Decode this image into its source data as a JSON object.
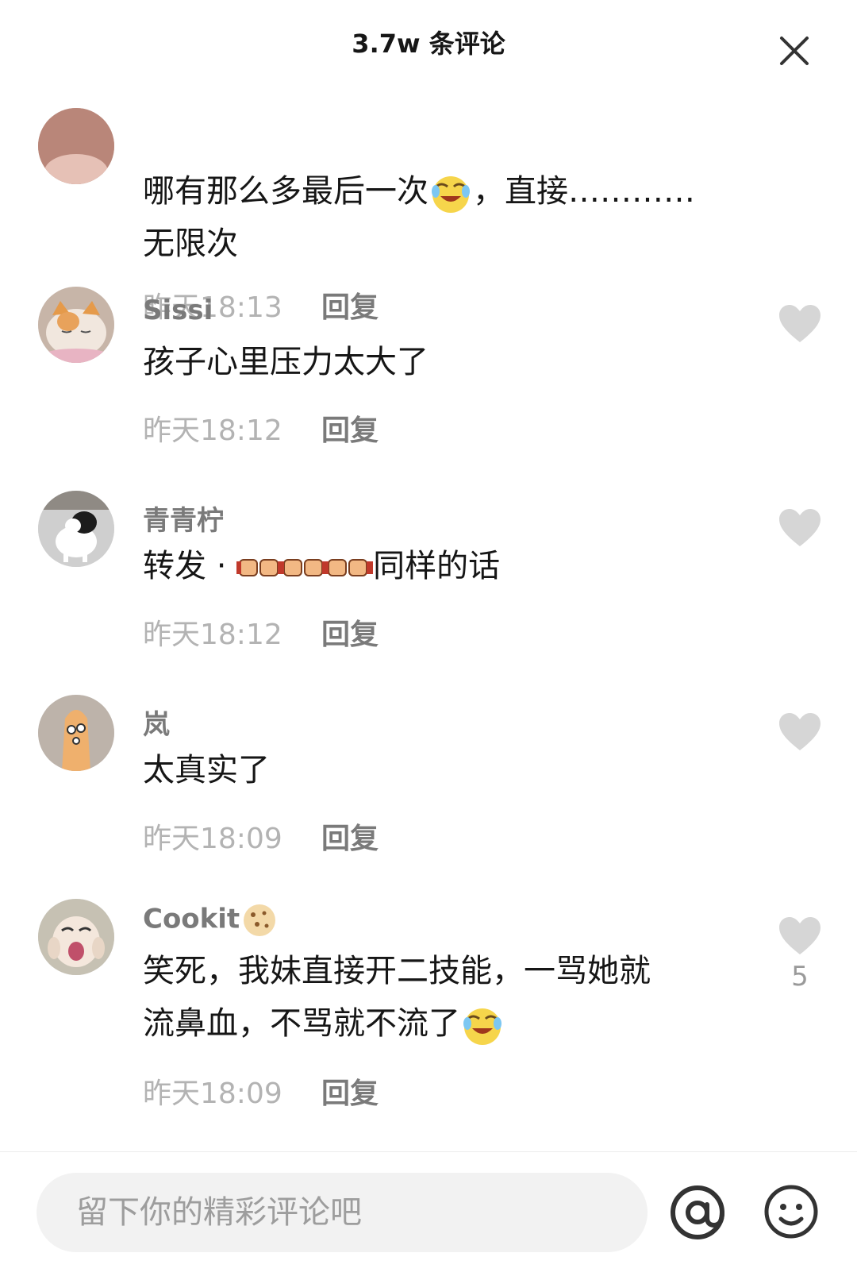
{
  "header": {
    "title": "3.7w 条评论",
    "close_icon": "close-icon"
  },
  "comments": [
    {
      "username": "",
      "content_parts": [
        "哪有那么多最后一次",
        "，直接…………",
        "无限次"
      ],
      "time": "昨天18:13",
      "reply": "回复",
      "liked": false
    },
    {
      "username": "Sissi",
      "content": "孩子心里压力太大了",
      "time": "昨天18:12",
      "reply": "回复"
    },
    {
      "username": "青青柠",
      "content_prefix": "转发 · ",
      "content_suffix": "同样的话",
      "time": "昨天18:12",
      "reply": "回复"
    },
    {
      "username": "岚",
      "content": "太真实了",
      "time": "昨天18:09",
      "reply": "回复"
    },
    {
      "username": "Cookit",
      "content_line1": "笑死，我妹直接开二技能，一骂她就",
      "content_line2": "流鼻血，不骂就不流了",
      "time": "昨天18:09",
      "reply": "回复",
      "like_count": "5"
    }
  ],
  "footer": {
    "placeholder": "留下你的精彩评论吧",
    "at_icon": "at-icon",
    "emoji_icon": "emoji-face-icon"
  },
  "colors": {
    "username": "#7a7a7a",
    "timestamp": "#b3b3b3",
    "heart": "#d6d6d6",
    "input_bg": "#f2f2f2"
  }
}
